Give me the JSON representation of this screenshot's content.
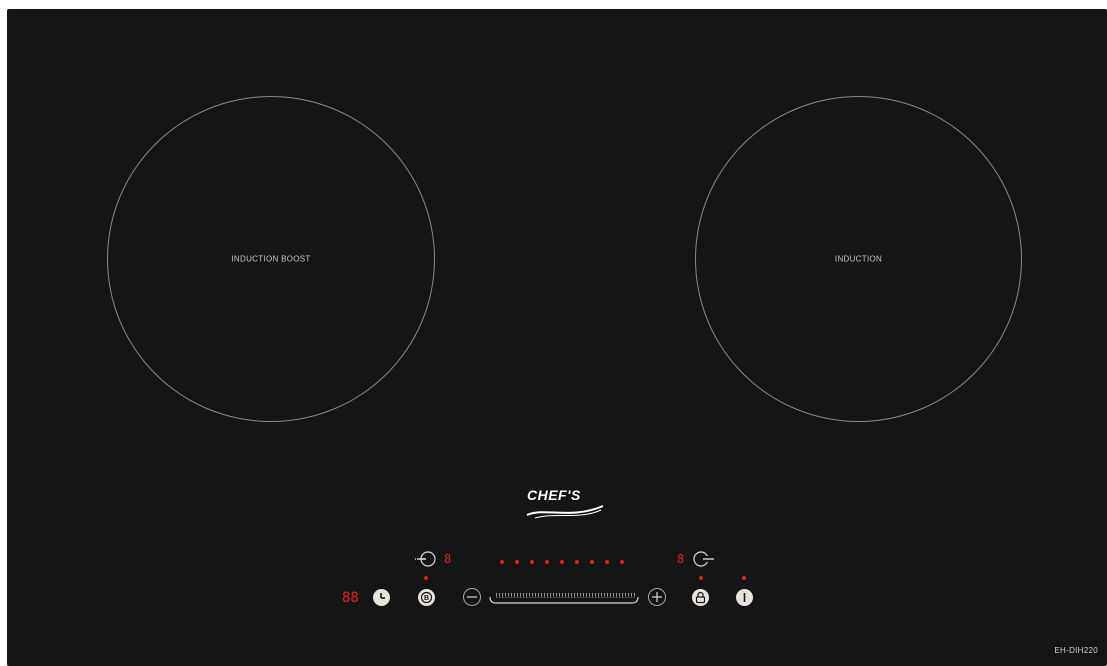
{
  "zones": {
    "left_label": "INDUCTION BOOST",
    "right_label": "INDUCTION"
  },
  "brand": {
    "name": "CHEF'S"
  },
  "controls": {
    "timer_display": "88",
    "left_zone_level": "8",
    "right_zone_level": "8",
    "power_level_dots": 9
  },
  "model": "EH-DIH220",
  "colors": {
    "panel": "#151515",
    "indicator": "#e0251b",
    "button": "#e9e4da",
    "ring": "#8a8a8a"
  },
  "icons": {
    "left_zone_select": "zone-left-select-icon",
    "right_zone_select": "zone-right-select-icon",
    "timer": "clock-icon",
    "boost": "boost-icon",
    "minus": "minus-icon",
    "plus": "plus-icon",
    "lock": "lock-icon",
    "power": "power-icon"
  }
}
